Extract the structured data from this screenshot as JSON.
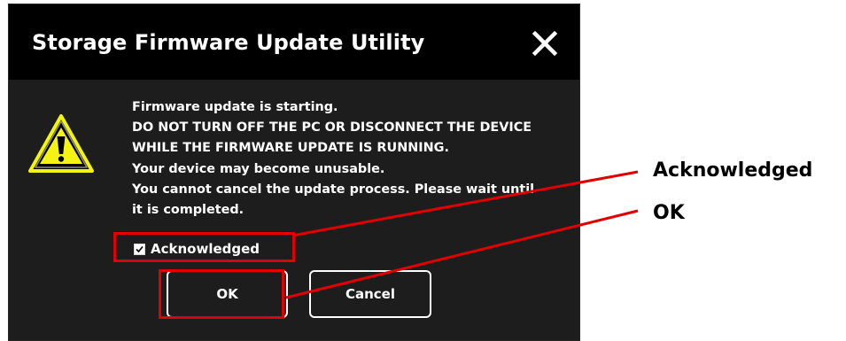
{
  "dialog": {
    "title": "Storage Firmware Update Utility",
    "close_icon": "close-icon",
    "warning_icon": "warning-triangle-icon",
    "message_lines": [
      "Firmware update is starting.",
      "DO NOT TURN OFF THE PC OR DISCONNECT THE DEVICE",
      "WHILE THE FIRMWARE UPDATE IS RUNNING.",
      "Your device may become unusable.",
      "You cannot cancel the update process. Please wait until",
      "it is completed."
    ],
    "acknowledge": {
      "label": "Acknowledged",
      "checked": true
    },
    "buttons": {
      "ok": "OK",
      "cancel": "Cancel"
    }
  },
  "annotations": {
    "acknowledged": "Acknowledged",
    "ok": "OK"
  },
  "colors": {
    "dialog_background": "#1d1d1d",
    "title_background": "#000000",
    "text": "#ffffff",
    "warning_yellow": "#f4f414",
    "highlight_red": "#e00000"
  }
}
